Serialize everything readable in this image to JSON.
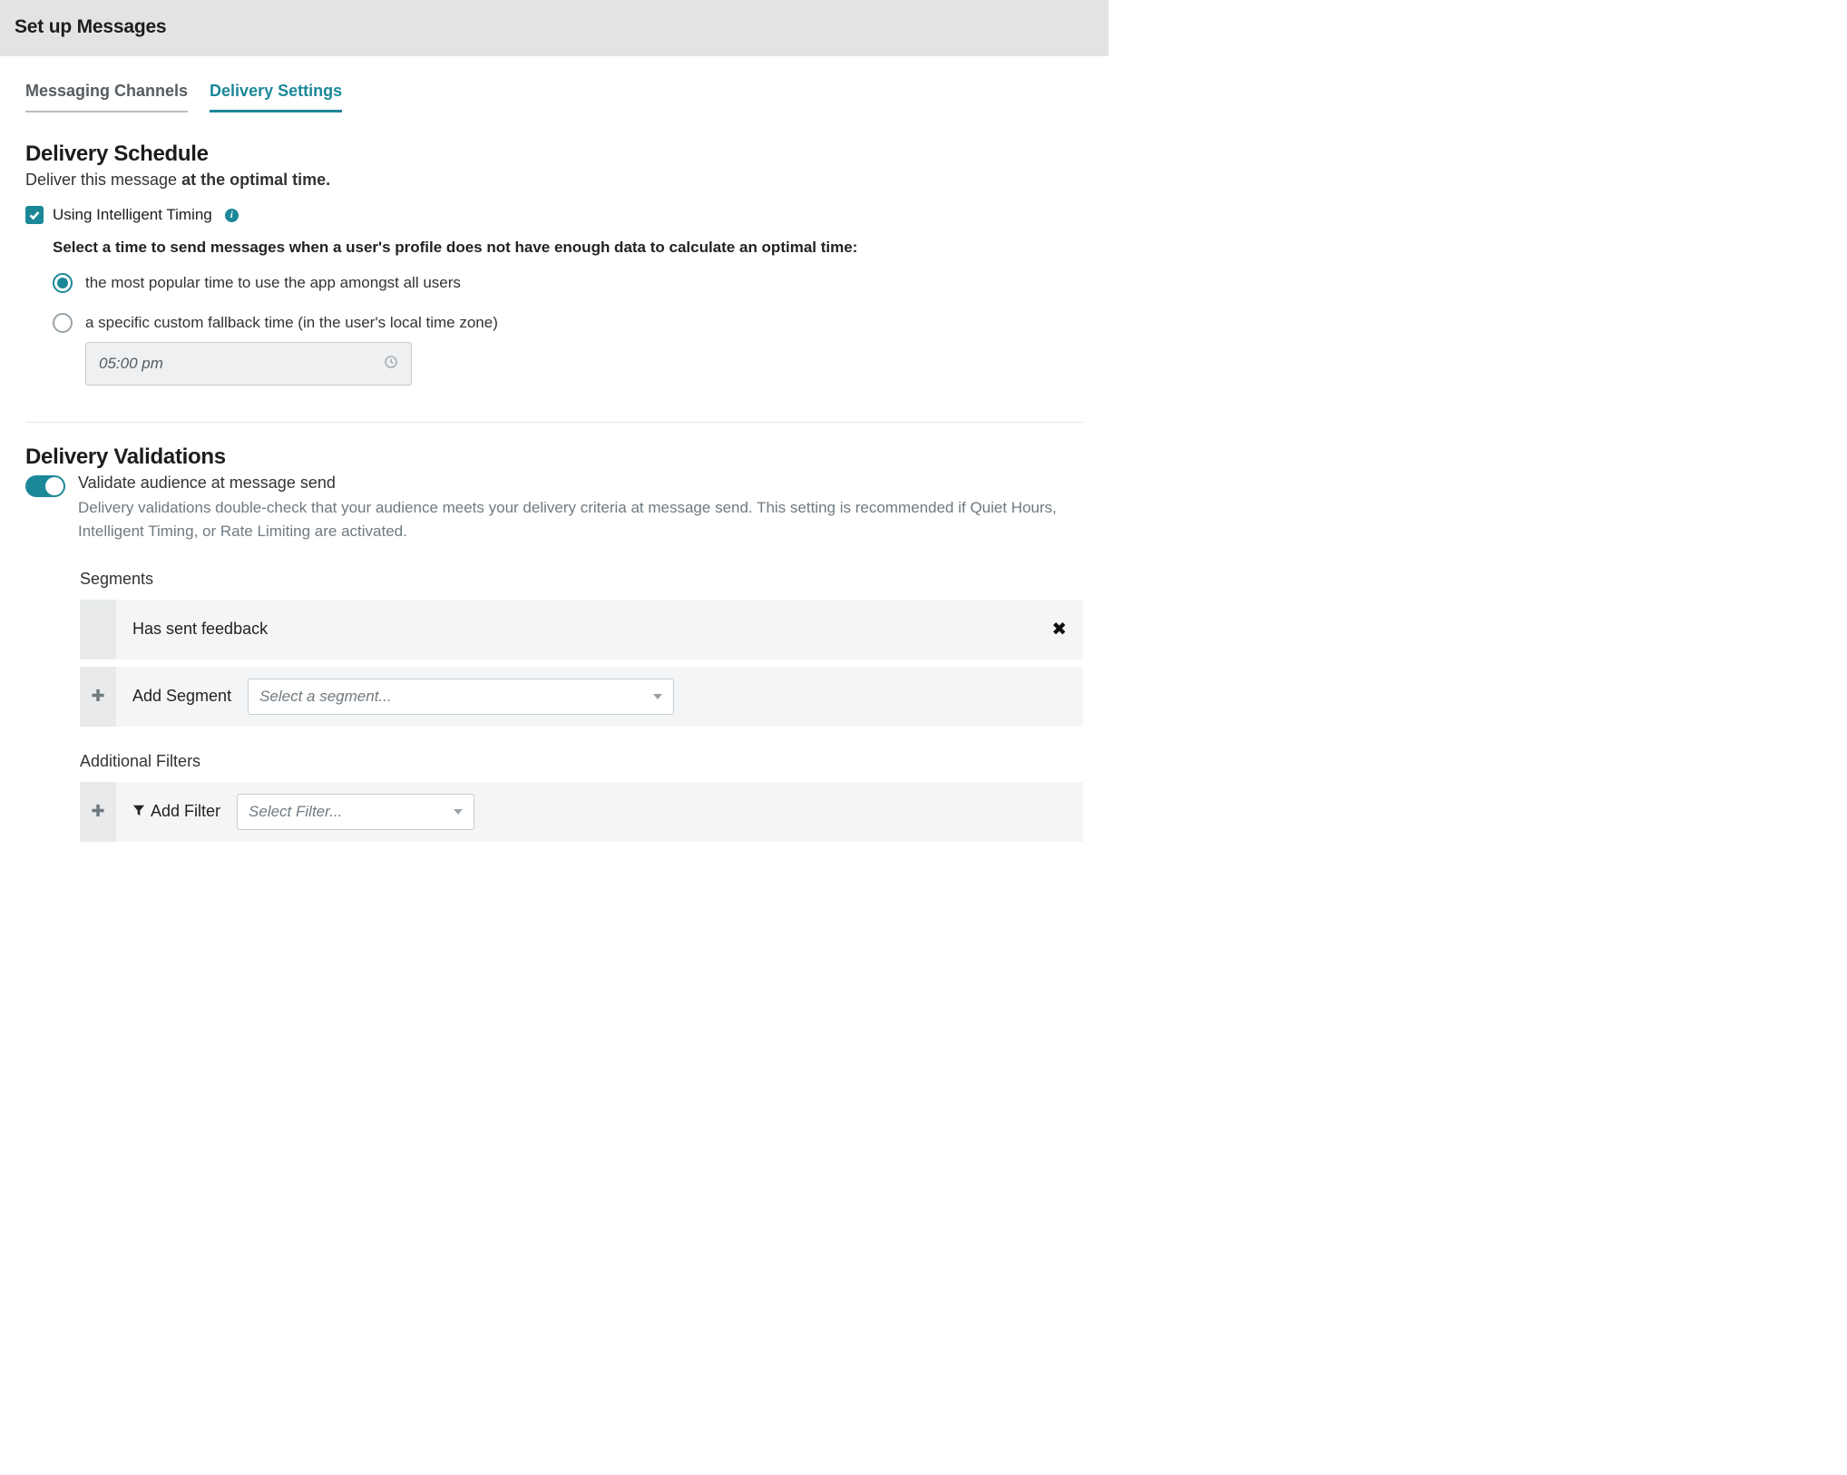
{
  "header": {
    "title": "Set up Messages"
  },
  "tabs": {
    "messaging": "Messaging Channels",
    "delivery": "Delivery Settings"
  },
  "schedule": {
    "title": "Delivery Schedule",
    "subtitle_prefix": "Deliver this message ",
    "subtitle_bold": "at the optimal time.",
    "checkbox_label": "Using Intelligent Timing",
    "info_glyph": "i",
    "fallback_prompt": "Select a time to send messages when a user's profile does not have enough data to calculate an optimal time:",
    "options": {
      "popular": "the most popular time to use the app amongst all users",
      "custom": "a specific custom fallback time (in the user's local time zone)"
    },
    "fallback_time": "05:00 pm"
  },
  "validations": {
    "title": "Delivery Validations",
    "toggle_label": "Validate audience at message send",
    "toggle_desc": "Delivery validations double-check that your audience meets your delivery criteria at message send. This setting is recommended if Quiet Hours, Intelligent Timing, or Rate Limiting are activated.",
    "segments_header": "Segments",
    "segment_items": [
      "Has sent feedback"
    ],
    "add_segment_label": "Add Segment",
    "segment_select_placeholder": "Select a segment...",
    "filters_header": "Additional Filters",
    "add_filter_label": "Add Filter",
    "filter_select_placeholder": "Select Filter...",
    "plus_glyph": "✚",
    "close_glyph": "✖"
  }
}
